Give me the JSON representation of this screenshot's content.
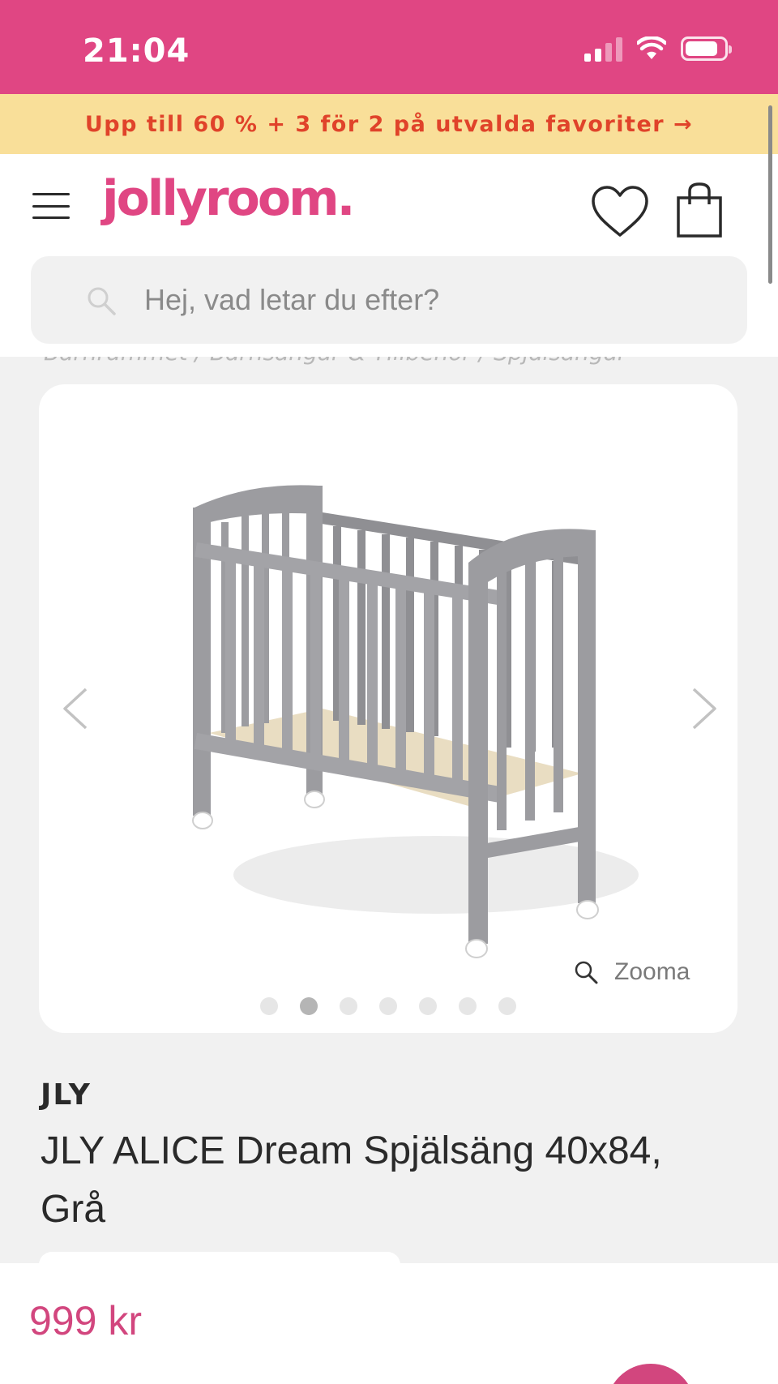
{
  "status_bar": {
    "time": "21:04",
    "icons": [
      "cellular-signal-icon",
      "wifi-icon",
      "battery-icon"
    ],
    "background": "#e04683"
  },
  "promo": {
    "text": "Upp till 60 % + 3 för 2 på utvalda favoriter →",
    "background": "#f9df99",
    "color": "#e0432a"
  },
  "header": {
    "logo": "jollyroom.",
    "brand_color": "#e04683",
    "icons": [
      "menu-icon",
      "heart-icon",
      "shopping-bag-icon"
    ]
  },
  "search": {
    "placeholder": "Hej, vad letar du efter?",
    "value": ""
  },
  "breadcrumb": {
    "items": [
      "Barnrummet",
      "Barnsängar & Tillbehör",
      "Spjälsängar"
    ],
    "separator": "/"
  },
  "gallery": {
    "zoom_label": "Zooma",
    "image_count": 7,
    "active_index": 1,
    "icons": [
      "chevron-left-icon",
      "chevron-right-icon",
      "magnifier-icon"
    ]
  },
  "product": {
    "brand": "JLY",
    "title": "JLY ALICE Dream Spjälsäng 40x84, Grå",
    "price": "999 kr",
    "price_color": "#d2467e"
  }
}
